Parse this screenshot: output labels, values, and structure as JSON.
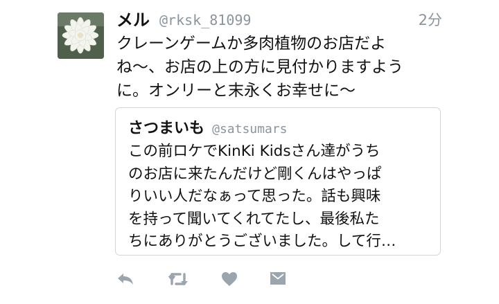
{
  "tweet": {
    "author_name": "メル",
    "author_handle": "@rksk_81099",
    "time": "2分",
    "text_lines": [
      "クレーンゲームか多肉植物のお店だよ",
      "ね〜、お店の上の方に見付かりますよう",
      "に。オンリーと末永くお幸せに〜"
    ]
  },
  "quoted": {
    "author_name": "さつまいも",
    "author_handle": "@satsumars",
    "text_lines": [
      "この前ロケでKinKi Kidsさん達がうち",
      "のお店に来たんだけど剛くんはやっぱ",
      "りいい人だなぁって思った。話も興味",
      "を持って聞いてくれてたし、最後私た",
      "ちにありがとうございました。して行…"
    ]
  },
  "actions": {
    "icons": [
      "reply-icon",
      "retweet-icon",
      "like-icon",
      "dm-icon"
    ],
    "icon_color": "#9aa5ae"
  }
}
